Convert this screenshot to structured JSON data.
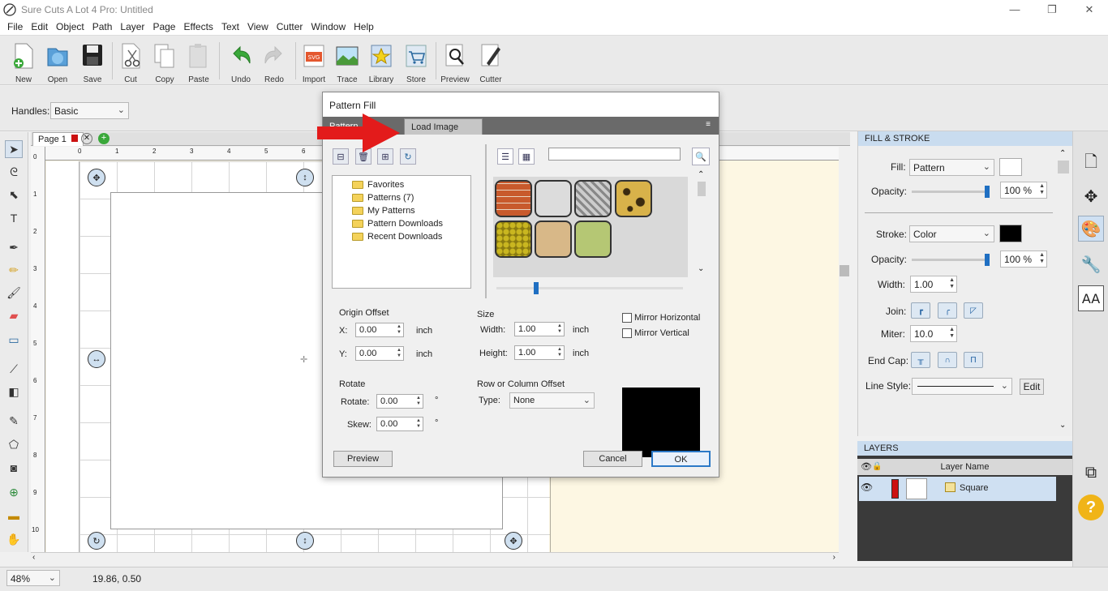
{
  "window": {
    "title": "Sure Cuts A Lot 4 Pro: Untitled",
    "controls": [
      "—",
      "❐",
      "✕"
    ]
  },
  "menu": [
    "File",
    "Edit",
    "Object",
    "Path",
    "Layer",
    "Page",
    "Effects",
    "Text",
    "View",
    "Cutter",
    "Window",
    "Help"
  ],
  "toolbar": {
    "new": "New",
    "open": "Open",
    "save": "Save",
    "cut": "Cut",
    "copy": "Copy",
    "paste": "Paste",
    "undo": "Undo",
    "redo": "Redo",
    "import": "Import",
    "trace": "Trace",
    "library": "Library",
    "store": "Store",
    "preview": "Preview",
    "cutter": "Cutter"
  },
  "handles": {
    "label": "Handles:",
    "value": "Basic"
  },
  "document": {
    "tab": "Page 1"
  },
  "ruler": {
    "h_ticks": [
      "0",
      "1",
      "2",
      "3",
      "4",
      "5",
      "6"
    ],
    "v_ticks": [
      "0",
      "1",
      "2",
      "3",
      "4",
      "5",
      "6",
      "7",
      "8",
      "9",
      "10"
    ]
  },
  "status": {
    "zoom": "48%",
    "coords": "19.86, 0.50"
  },
  "fill_stroke": {
    "title": "FILL & STROKE",
    "fill_label": "Fill:",
    "fill_value": "Pattern",
    "opacity_label": "Opacity:",
    "fill_opacity": "100 %",
    "stroke_label": "Stroke:",
    "stroke_value": "Color",
    "stroke_opacity": "100 %",
    "width_label": "Width:",
    "width_value": "1.00",
    "join_label": "Join:",
    "miter_label": "Miter:",
    "miter_value": "10.0",
    "endcap_label": "End Cap:",
    "linestyle_label": "Line Style:",
    "edit_label": "Edit",
    "fill_color": "#ffffff",
    "stroke_color": "#000000"
  },
  "layers": {
    "title": "LAYERS",
    "header": "Layer Name",
    "items": [
      {
        "name": "Square",
        "color": "#cc1111"
      }
    ]
  },
  "dialog": {
    "title": "Pattern Fill",
    "tab_pattern": "Pattern",
    "tab_load": "Load Image",
    "tree": [
      "Favorites",
      "Patterns (7)",
      "My Patterns",
      "Pattern Downloads",
      "Recent Downloads"
    ],
    "search_placeholder": "",
    "patterns": [
      "brick",
      "plain-grey",
      "diamond-plate",
      "leopard",
      "green-scales",
      "sand-stone",
      "green-plain"
    ],
    "origin_offset": {
      "label": "Origin Offset",
      "x_label": "X:",
      "x": "0.00",
      "y_label": "Y:",
      "y": "0.00",
      "unit": "inch"
    },
    "size": {
      "label": "Size",
      "width_label": "Width:",
      "width": "1.00",
      "height_label": "Height:",
      "height": "1.00",
      "unit": "inch"
    },
    "mirror_h": "Mirror Horizontal",
    "mirror_v": "Mirror Vertical",
    "rotate": {
      "label": "Rotate",
      "rotate_label": "Rotate:",
      "rotate": "0.00",
      "skew_label": "Skew:",
      "skew": "0.00",
      "deg": "°"
    },
    "row_col": {
      "label": "Row or Column Offset",
      "type_label": "Type:",
      "type": "None"
    },
    "preview_btn": "Preview",
    "cancel_btn": "Cancel",
    "ok_btn": "OK"
  },
  "colors": {
    "accent": "#1f6fc2",
    "panel_header": "#c9dcef",
    "arrow": "#e31b1b"
  }
}
